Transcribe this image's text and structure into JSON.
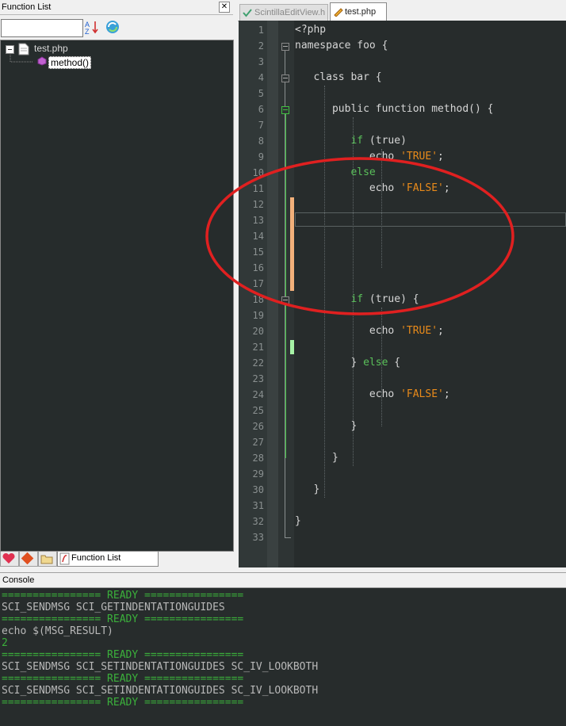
{
  "function_list": {
    "title": "Function List",
    "close_label": "✕",
    "search_value": "",
    "tree": {
      "file": "test.php",
      "method": "method()"
    },
    "bottom_tab_label": "Function List"
  },
  "editor": {
    "tabs": [
      {
        "label": "ScintillaEditView.h",
        "active": false
      },
      {
        "label": "test.php",
        "active": true
      }
    ],
    "lines": [
      "1",
      "2",
      "3",
      "4",
      "5",
      "6",
      "7",
      "8",
      "9",
      "10",
      "11",
      "12",
      "13",
      "14",
      "15",
      "16",
      "17",
      "18",
      "19",
      "20",
      "21",
      "22",
      "23",
      "24",
      "25",
      "26",
      "27",
      "28",
      "29",
      "30",
      "31",
      "32",
      "33"
    ],
    "code": {
      "l1": "<?php",
      "l2": "namespace foo {",
      "l4_kw": "class",
      "l4_rest": " bar {",
      "l6_kw1": "public",
      "l6_kw2": "function",
      "l6_rest": " method() {",
      "l8_kw": "if",
      "l8_rest": " (true)",
      "l9_echo": "echo ",
      "l9_str": "'TRUE'",
      "l9_end": ";",
      "l10_kw": "else",
      "l11_echo": "echo ",
      "l11_str": "'FALSE'",
      "l11_end": ";",
      "l18_kw": "if",
      "l18_rest": " (true) {",
      "l20_echo": "echo ",
      "l20_str": "'TRUE'",
      "l20_end": ";",
      "l22_brace": "} ",
      "l22_kw": "else",
      "l22_rest": " {",
      "l24_echo": "echo ",
      "l24_str": "'FALSE'",
      "l24_end": ";",
      "l26": "}",
      "l28": "}",
      "l30": "}",
      "l32": "}"
    }
  },
  "console": {
    "title": "Console",
    "lines": [
      {
        "text": "================ READY ================",
        "kind": "sep"
      },
      {
        "text": "SCI_SENDMSG SCI_GETINDENTATIONGUIDES",
        "kind": "cmd"
      },
      {
        "text": "================ READY ================",
        "kind": "sep"
      },
      {
        "text": "echo $(MSG_RESULT)",
        "kind": "cmd"
      },
      {
        "text": "2",
        "kind": "res"
      },
      {
        "text": "================ READY ================",
        "kind": "sep"
      },
      {
        "text": "SCI_SENDMSG SCI_SETINDENTATIONGUIDES SC_IV_LOOKBOTH",
        "kind": "cmd"
      },
      {
        "text": "================ READY ================",
        "kind": "sep"
      },
      {
        "text": "SCI_SENDMSG SCI_SETINDENTATIONGUIDES SC_IV_LOOKBOTH",
        "kind": "cmd"
      },
      {
        "text": "================ READY ================",
        "kind": "sep"
      }
    ]
  },
  "colors": {
    "editor_bg": "#272c2c",
    "keyword": "#5ac05a",
    "string": "#e88a1a",
    "annotation_circle": "#e02020",
    "changed_marker": "#f2b07a",
    "saved_marker": "#a6f2a6"
  },
  "icons": [
    "sort-alpha-icon",
    "reload-icon",
    "php-file-icon",
    "method-icon",
    "edit-pencil-icon",
    "check-icon"
  ]
}
